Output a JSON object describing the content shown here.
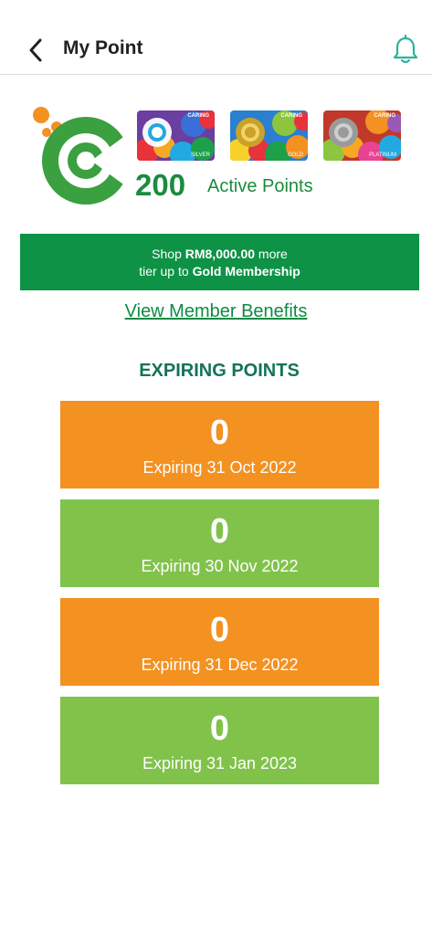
{
  "header": {
    "title": "My Point",
    "back_icon": "chevron-left-icon",
    "notification_icon": "bell-icon"
  },
  "cards": [
    {
      "brand": "CARING",
      "tier": "SILVER"
    },
    {
      "brand": "CARING",
      "tier": "GOLD"
    },
    {
      "brand": "CARING",
      "tier": "PLATINUM"
    }
  ],
  "points": {
    "value": "200",
    "label": "Active Points"
  },
  "banner": {
    "line1_prefix": "Shop",
    "amount": "RM8,000.00",
    "line1_suffix": "more",
    "line2_prefix": "tier up to",
    "tier": "Gold Membership"
  },
  "benefits_link": "View Member Benefits",
  "expiring": {
    "title": "EXPIRING POINTS",
    "items": [
      {
        "value": "0",
        "label": "Expiring 31 Oct 2022",
        "color": "#f39121"
      },
      {
        "value": "0",
        "label": "Expiring 30 Nov 2022",
        "color": "#81c24b"
      },
      {
        "value": "0",
        "label": "Expiring 31 Dec 2022",
        "color": "#f39121"
      },
      {
        "value": "0",
        "label": "Expiring 31 Jan 2023",
        "color": "#81c24b"
      }
    ]
  },
  "colors": {
    "brand_green": "#0e9246",
    "text_green": "#1b8c3e",
    "orange": "#f39121",
    "light_green": "#81c24b"
  }
}
